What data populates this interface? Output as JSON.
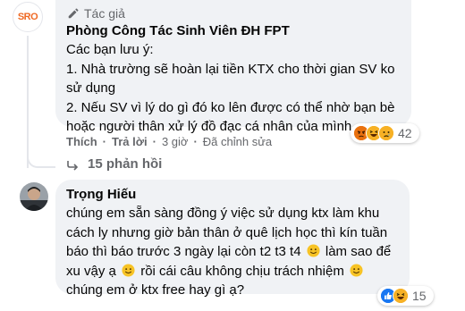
{
  "comment1": {
    "avatar_text": "SRO",
    "badge_label": "Tác giả",
    "author": "Phòng Công Tác Sinh Viên ĐH FPT",
    "lines": [
      "Các bạn lưu ý:",
      "1. Nhà trường sẽ hoàn lại tiền KTX cho thời gian SV ko",
      "sử dụng",
      "2. Nếu SV vì lý do gì đó ko lên được có thể nhờ bạn bè",
      "hoặc người thân xử lý đồ đạc cá nhân của mình"
    ],
    "reactions": {
      "icons": [
        "angry-emoji",
        "haha-emoji",
        "sad-emoji"
      ],
      "count": "42"
    },
    "actions": {
      "like": "Thích",
      "reply": "Trả lời",
      "time": "3 giờ",
      "edited": "Đã chỉnh sửa"
    },
    "replies_link": "15 phản hồi"
  },
  "comment2": {
    "author": "Trọng Hiếu",
    "lines": [
      "chúng em sẵn sàng đồng ý việc sử dụng ktx làm khu",
      "cách ly nhưng giờ bản thân ở quê lịch học thì kín tuần",
      {
        "a": "báo thì báo trước 3 ngày lại còn t2 t3 t4 ",
        "b": " làm sao để"
      },
      {
        "a": "xu vậy ạ ",
        "b": " rồi cái câu không chịu trách nhiệm "
      },
      "chúng em ở ktx free hay gì ạ?"
    ],
    "reactions": {
      "icons": [
        "like-emoji",
        "haha-emoji"
      ],
      "count": "15"
    }
  },
  "colors": {
    "bubble_bg": "#f0f2f5",
    "meta_text": "#65676b",
    "like_blue": "#1877f2",
    "emoji_yellow": "#f7b125",
    "angry_red": "#e9710f",
    "logo_orange": "#ef6a25"
  }
}
